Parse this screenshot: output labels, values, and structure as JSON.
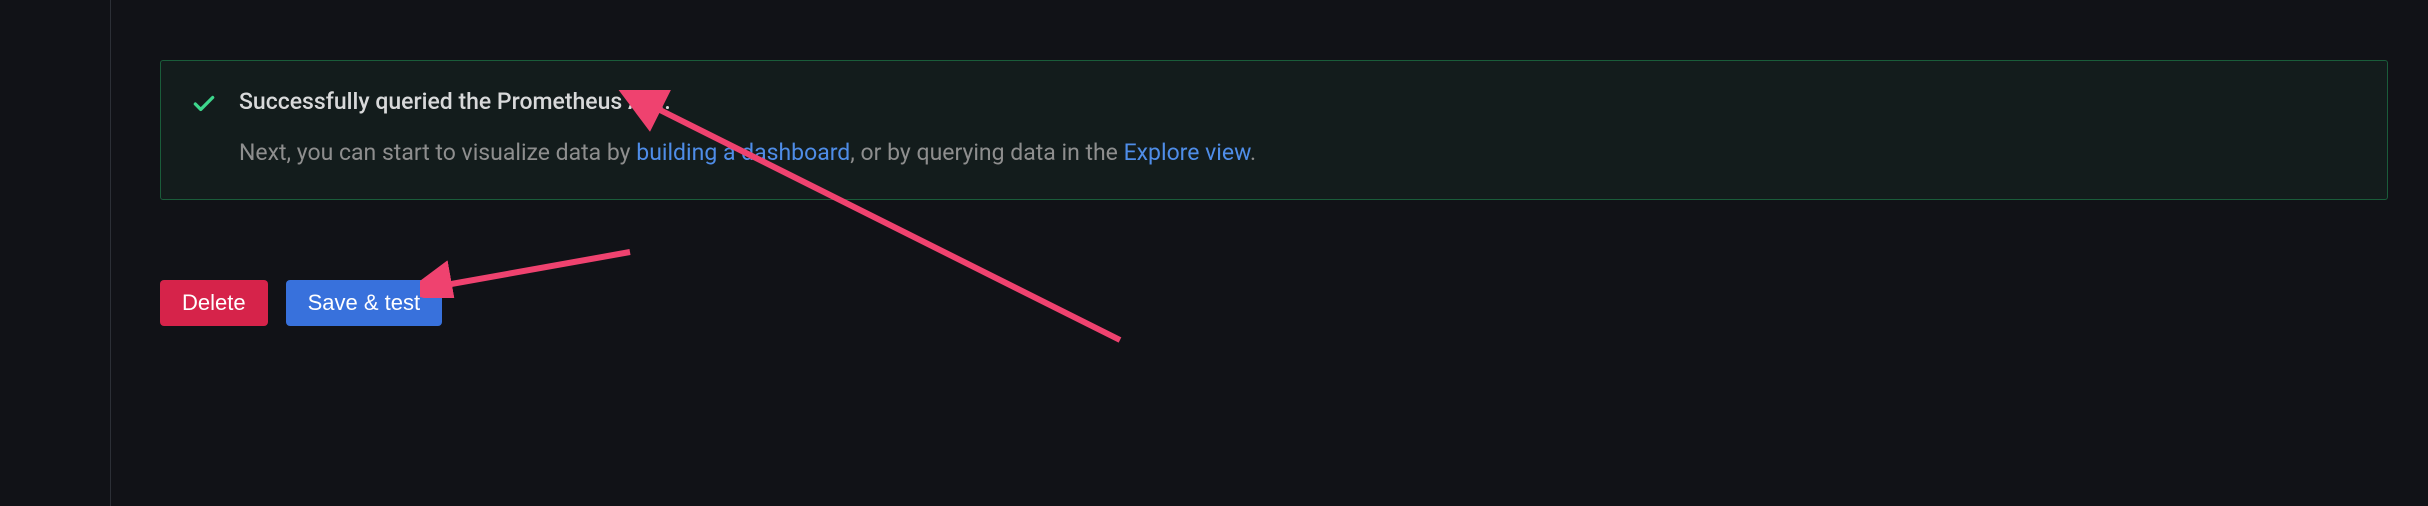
{
  "alert": {
    "title": "Successfully queried the Prometheus API.",
    "text_prefix": "Next, you can start to visualize data by ",
    "link1": "building a dashboard",
    "text_mid": ", or by querying data in the ",
    "link2": "Explore view",
    "text_suffix": "."
  },
  "buttons": {
    "delete_label": "Delete",
    "save_label": "Save & test"
  },
  "colors": {
    "success_check": "#3dd68c",
    "arrow": "#ef426f"
  }
}
